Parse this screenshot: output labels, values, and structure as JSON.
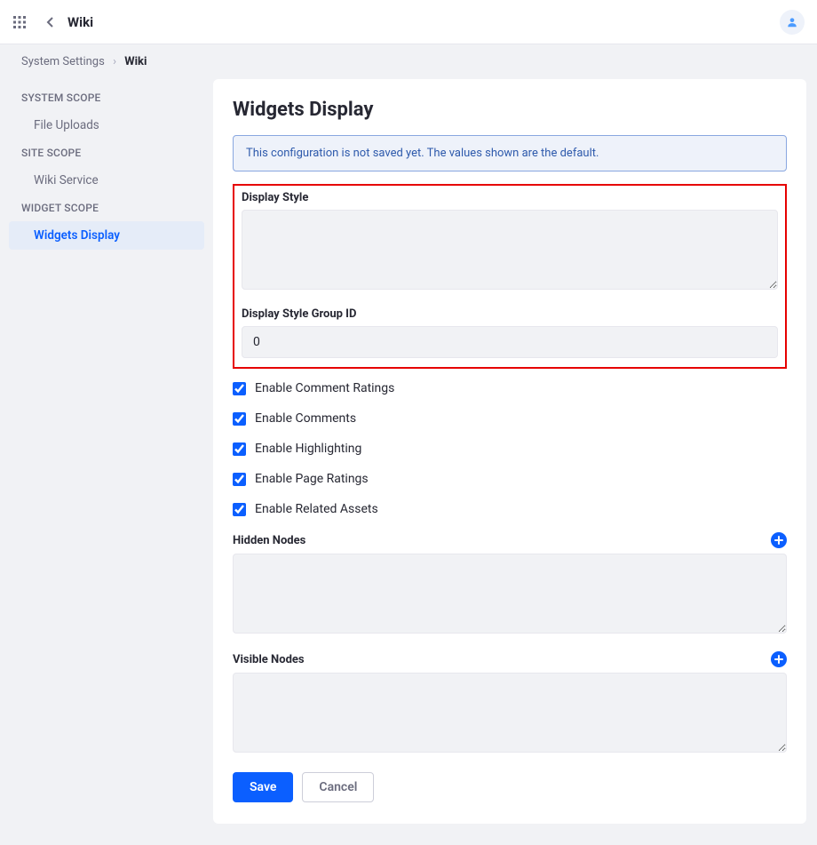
{
  "topbar": {
    "title": "Wiki"
  },
  "breadcrumb": {
    "parent": "System Settings",
    "current": "Wiki"
  },
  "sidebar": {
    "scopes": [
      {
        "label": "SYSTEM SCOPE",
        "items": [
          {
            "label": "File Uploads",
            "active": false
          }
        ]
      },
      {
        "label": "SITE SCOPE",
        "items": [
          {
            "label": "Wiki Service",
            "active": false
          }
        ]
      },
      {
        "label": "WIDGET SCOPE",
        "items": [
          {
            "label": "Widgets Display",
            "active": true
          }
        ]
      }
    ]
  },
  "page": {
    "title": "Widgets Display",
    "alert": "This configuration is not saved yet. The values shown are the default.",
    "fields": {
      "display_style_label": "Display Style",
      "display_style_value": "",
      "display_style_group_id_label": "Display Style Group ID",
      "display_style_group_id_value": "0",
      "hidden_nodes_label": "Hidden Nodes",
      "hidden_nodes_value": "",
      "visible_nodes_label": "Visible Nodes",
      "visible_nodes_value": ""
    },
    "checkboxes": {
      "enable_comment_ratings": "Enable Comment Ratings",
      "enable_comments": "Enable Comments",
      "enable_highlighting": "Enable Highlighting",
      "enable_page_ratings": "Enable Page Ratings",
      "enable_related_assets": "Enable Related Assets"
    },
    "buttons": {
      "save": "Save",
      "cancel": "Cancel"
    }
  }
}
